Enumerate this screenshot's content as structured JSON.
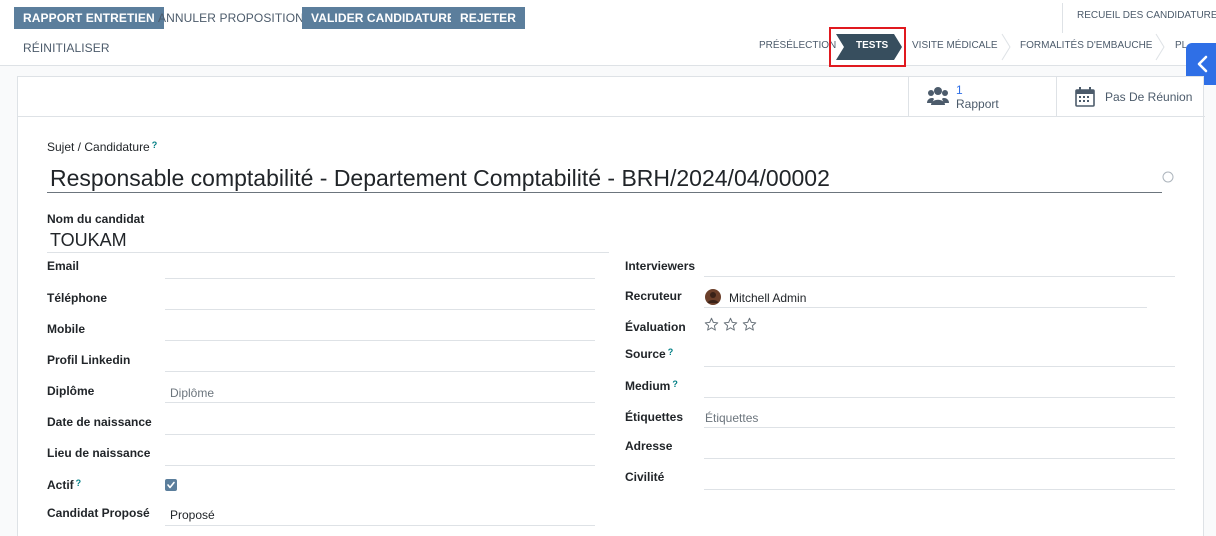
{
  "actions": {
    "rapport": "RAPPORT ENTRETIEN",
    "annuler": "ANNULER PROPOSITION",
    "valider": "VALIDER CANDIDATURE",
    "rejeter": "REJETER",
    "reinitialiser": "RÉINITIALISER"
  },
  "stages": {
    "top": "RECUEIL DES CANDIDATURES",
    "preselection": "PRÉSÉLECTION",
    "tests": "TESTS",
    "visite": "VISITE MÉDICALE",
    "formalites": "FORMALITÉS D'EMBAUCHE",
    "more": "PL",
    "active": "TESTS"
  },
  "smart_buttons": {
    "rapport_count": "1",
    "rapport_label": "Rapport",
    "reunion_label": "Pas De Réunion"
  },
  "form": {
    "subject_label": "Sujet / Candidature",
    "subject_help": "?",
    "subject_value": "Responsable comptabilité - Departement Comptabilité - BRH/2024/04/00002",
    "candidate_label": "Nom du candidat",
    "candidate_value": "TOUKAM",
    "left": {
      "email": "Email",
      "telephone": "Téléphone",
      "mobile": "Mobile",
      "linkedin": "Profil Linkedin",
      "diplome": "Diplôme",
      "diplome_placeholder": "Diplôme",
      "naissance_date": "Date de naissance",
      "naissance_lieu": "Lieu de naissance",
      "actif": "Actif",
      "actif_help": "?",
      "actif_checked": true,
      "propose": "Candidat Proposé",
      "propose_value": "Proposé"
    },
    "right": {
      "interviewers": "Interviewers",
      "recruteur": "Recruteur",
      "recruteur_value": "Mitchell Admin",
      "evaluation": "Évaluation",
      "evaluation_stars": 0,
      "evaluation_max": 3,
      "source": "Source",
      "source_help": "?",
      "medium": "Medium",
      "medium_help": "?",
      "etiquettes": "Étiquettes",
      "etiquettes_placeholder": "Étiquettes",
      "adresse": "Adresse",
      "civilite": "Civilité"
    }
  },
  "colors": {
    "primary": "#71639e",
    "action_blue": "#5b7e9c",
    "stage_active": "#374e5e",
    "highlight": "#e0191f",
    "side_tab": "#2f6fe6",
    "checkbox": "#5b7e9c"
  }
}
